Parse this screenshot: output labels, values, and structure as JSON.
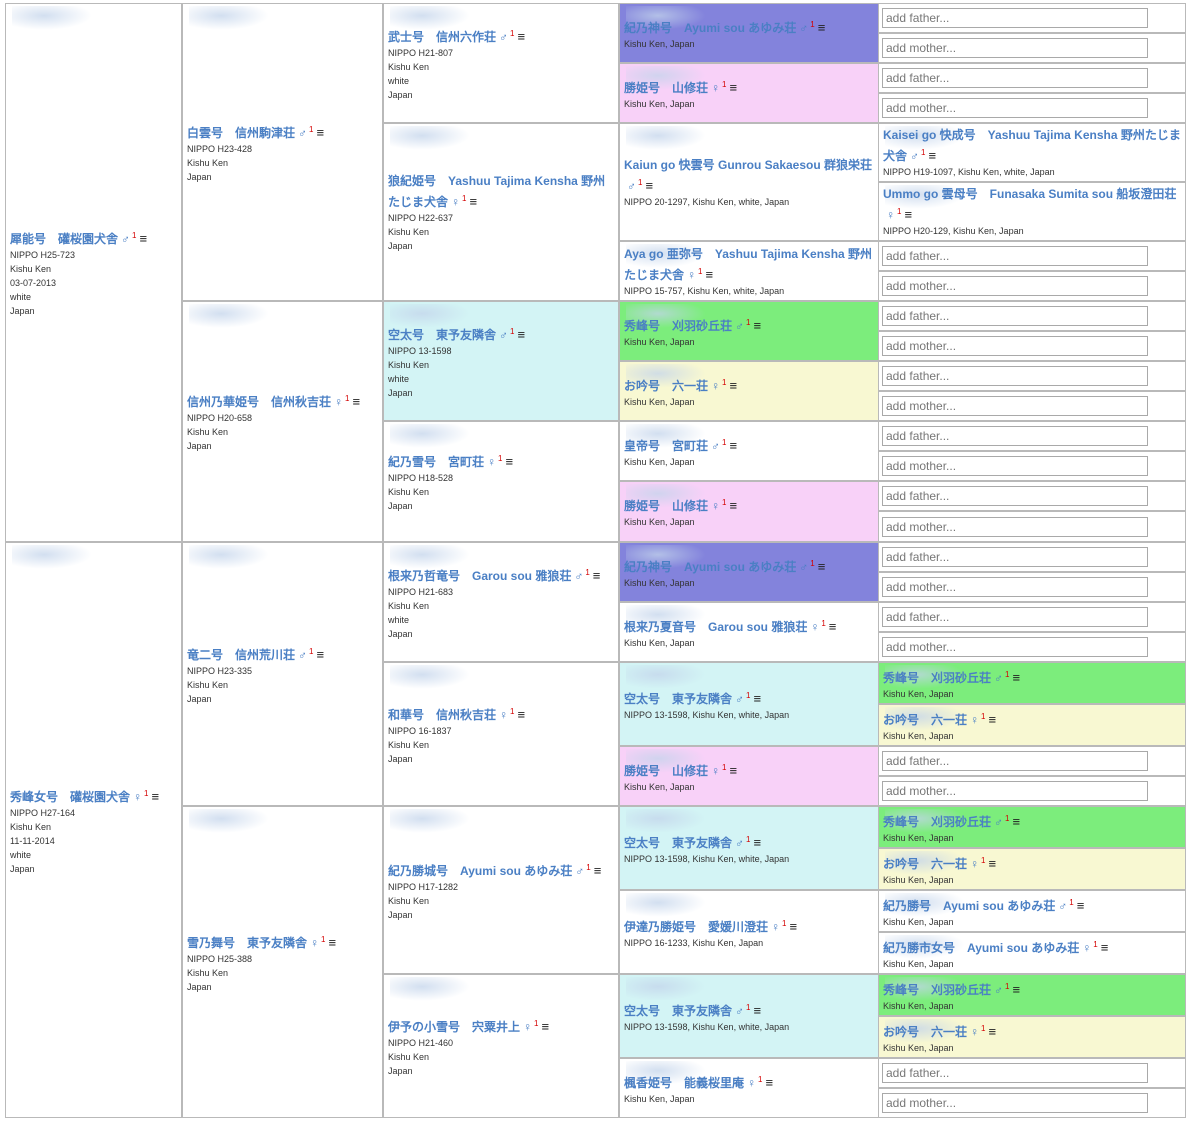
{
  "colors": {
    "link": "#4a7fc4",
    "purple": "#8383dc",
    "pink": "#f8d1f8",
    "cyan": "#d3f4f5",
    "green": "#7ced7c",
    "yellow": "#f8f8d2",
    "border": "#b9b9b9"
  },
  "placeholders": {
    "father": "add father...",
    "mother": "add mother..."
  },
  "menu_icon": "≡",
  "dogs": {
    "d0": {
      "name": "犀能号　礶桜園犬舎",
      "sym": "♂",
      "sup": "1",
      "details": [
        "NIPPO H25-723",
        "Kishu Ken",
        "03-07-2013",
        "white",
        "Japan"
      ]
    },
    "d1": {
      "name": "秀峰女号　礶桜園犬舎",
      "sym": "♀",
      "sup": "1",
      "details": [
        "NIPPO H27-164",
        "Kishu Ken",
        "11-11-2014",
        "white",
        "Japan"
      ]
    },
    "d2": {
      "name": "白雲号　信州駒津荘",
      "sym": "♂",
      "sup": "1",
      "details": [
        "NIPPO H23-428",
        "Kishu Ken",
        "Japan"
      ]
    },
    "d3": {
      "name": "信州乃華姫号　信州秋吉荘",
      "sym": "♀",
      "sup": "1",
      "details": [
        "NIPPO H20-658",
        "Kishu Ken",
        "Japan"
      ]
    },
    "d4": {
      "name": "竜二号　信州荒川荘",
      "sym": "♂",
      "sup": "1",
      "details": [
        "NIPPO H23-335",
        "Kishu Ken",
        "Japan"
      ]
    },
    "d5": {
      "name": "雪乃舞号　東予友隣舎",
      "sym": "♀",
      "sup": "1",
      "details": [
        "NIPPO H25-388",
        "Kishu Ken",
        "Japan"
      ]
    },
    "d6": {
      "name": "武士号　信州六作荘",
      "sym": "♂",
      "sup": "1",
      "details": [
        "NIPPO H21-807",
        "Kishu Ken",
        "white",
        "Japan"
      ]
    },
    "d7": {
      "name": "狼紀姫号　Yashuu Tajima Kensha 野州たじま犬舎",
      "sym": "♀",
      "sup": "1",
      "details": [
        "NIPPO H22-637",
        "Kishu Ken",
        "Japan"
      ]
    },
    "d8": {
      "name": "空太号　東予友隣舎",
      "sym": "♂",
      "sup": "1",
      "details": [
        "NIPPO 13-1598",
        "Kishu Ken",
        "white",
        "Japan"
      ]
    },
    "d9": {
      "name": "紀乃雪号　宮町荘",
      "sym": "♀",
      "sup": "1",
      "details": [
        "NIPPO H18-528",
        "Kishu Ken",
        "Japan"
      ]
    },
    "d10": {
      "name": "根来乃哲竜号　Garou sou 雅狼荘",
      "sym": "♂",
      "sup": "1",
      "details": [
        "NIPPO H21-683",
        "Kishu Ken",
        "white",
        "Japan"
      ]
    },
    "d11": {
      "name": "和華号　信州秋吉荘",
      "sym": "♀",
      "sup": "1",
      "details": [
        "NIPPO 16-1837",
        "Kishu Ken",
        "Japan"
      ]
    },
    "d12": {
      "name": "紀乃勝城号　Ayumi sou あゆみ荘",
      "sym": "♂",
      "sup": "1",
      "details": [
        "NIPPO H17-1282",
        "Kishu Ken",
        "Japan"
      ]
    },
    "d13": {
      "name": "伊予の小雪号　宍粟井上",
      "sym": "♀",
      "sup": "1",
      "details": [
        "NIPPO H21-460",
        "Kishu Ken",
        "Japan"
      ]
    },
    "d14": {
      "name": "紀乃神号　Ayumi sou あゆみ荘",
      "sym": "♂",
      "sup": "1",
      "details": [
        "Kishu Ken, Japan"
      ]
    },
    "d15": {
      "name": "勝姫号　山修荘",
      "sym": "♀",
      "sup": "1",
      "details": [
        "Kishu Ken, Japan"
      ]
    },
    "d16": {
      "name": "Kaiun go 快雲号 Gunrou Sakaesou 群狼栄荘",
      "sym": "♂",
      "sup": "1",
      "details": [
        "NIPPO 20-1297, Kishu Ken, white, Japan"
      ]
    },
    "d17": {
      "name": "Aya go 亜弥号　Yashuu Tajima Kensha 野州たじま犬舎",
      "sym": "♀",
      "sup": "1",
      "details": [
        "NIPPO 15-757, Kishu Ken, white, Japan"
      ]
    },
    "d18": {
      "name": "秀峰号　刈羽砂丘荘",
      "sym": "♂",
      "sup": "1",
      "details": [
        "Kishu Ken, Japan"
      ]
    },
    "d19": {
      "name": "お吟号　六一荘",
      "sym": "♀",
      "sup": "1",
      "details": [
        "Kishu Ken, Japan"
      ]
    },
    "d20": {
      "name": "皇帝号　宮町荘",
      "sym": "♂",
      "sup": "1",
      "details": [
        "Kishu Ken, Japan"
      ]
    },
    "d21": {
      "name": "勝姫号　山修荘",
      "sym": "♀",
      "sup": "1",
      "details": [
        "Kishu Ken, Japan"
      ]
    },
    "d22": {
      "name": "紀乃神号　Ayumi sou あゆみ荘",
      "sym": "♂",
      "sup": "1",
      "details": [
        "Kishu Ken, Japan"
      ]
    },
    "d23": {
      "name": "根来乃夏音号　Garou sou 雅狼荘",
      "sym": "♀",
      "sup": "1",
      "details": [
        "Kishu Ken, Japan"
      ]
    },
    "d24": {
      "name": "空太号　東予友隣舎",
      "sym": "♂",
      "sup": "1",
      "details": [
        "NIPPO 13-1598, Kishu Ken, white, Japan"
      ]
    },
    "d25": {
      "name": "勝姫号　山修荘",
      "sym": "♀",
      "sup": "1",
      "details": [
        "Kishu Ken, Japan"
      ]
    },
    "d26": {
      "name": "空太号　東予友隣舎",
      "sym": "♂",
      "sup": "1",
      "details": [
        "NIPPO 13-1598, Kishu Ken, white, Japan"
      ]
    },
    "d27": {
      "name": "伊達乃勝姫号　愛媛川澄荘",
      "sym": "♀",
      "sup": "1",
      "details": [
        "NIPPO 16-1233, Kishu Ken, Japan"
      ]
    },
    "d28": {
      "name": "空太号　東予友隣舎",
      "sym": "♂",
      "sup": "1",
      "details": [
        "NIPPO 13-1598, Kishu Ken, white, Japan"
      ]
    },
    "d29": {
      "name": "楓香姫号　能義桜里庵",
      "sym": "♀",
      "sup": "1",
      "details": [
        "Kishu Ken, Japan"
      ]
    },
    "d30": {
      "name": "Kaisei go 快成号　Yashuu Tajima Kensha 野州たじま犬舎",
      "sym": "♂",
      "sup": "1",
      "details": [
        "NIPPO H19-1097, Kishu Ken, white, Japan"
      ]
    },
    "d31": {
      "name": "Ummo go 雲母号　Funasaka Sumita sou 船坂澄田荘",
      "sym": "♀",
      "sup": "1",
      "details": [
        "NIPPO H20-129, Kishu Ken, Japan"
      ]
    },
    "d32": {
      "name": "秀峰号　刈羽砂丘荘",
      "sym": "♂",
      "sup": "1",
      "details": [
        "Kishu Ken, Japan"
      ]
    },
    "d33": {
      "name": "お吟号　六一荘",
      "sym": "♀",
      "sup": "1",
      "details": [
        "Kishu Ken, Japan"
      ]
    },
    "d34": {
      "name": "秀峰号　刈羽砂丘荘",
      "sym": "♂",
      "sup": "1",
      "details": [
        "Kishu Ken, Japan"
      ]
    },
    "d35": {
      "name": "お吟号　六一荘",
      "sym": "♀",
      "sup": "1",
      "details": [
        "Kishu Ken, Japan"
      ]
    },
    "d36": {
      "name": "紀乃勝号　Ayumi sou あゆみ荘",
      "sym": "♂",
      "sup": "1",
      "details": [
        "Kishu Ken, Japan"
      ]
    },
    "d37": {
      "name": "紀乃勝市女号　Ayumi sou あゆみ荘",
      "sym": "♀",
      "sup": "1",
      "details": [
        "Kishu Ken, Japan"
      ]
    },
    "d38": {
      "name": "秀峰号　刈羽砂丘荘",
      "sym": "♂",
      "sup": "1",
      "details": [
        "Kishu Ken, Japan"
      ]
    },
    "d39": {
      "name": "お吟号　六一荘",
      "sym": "♀",
      "sup": "1",
      "details": [
        "Kishu Ken, Japan"
      ]
    }
  }
}
